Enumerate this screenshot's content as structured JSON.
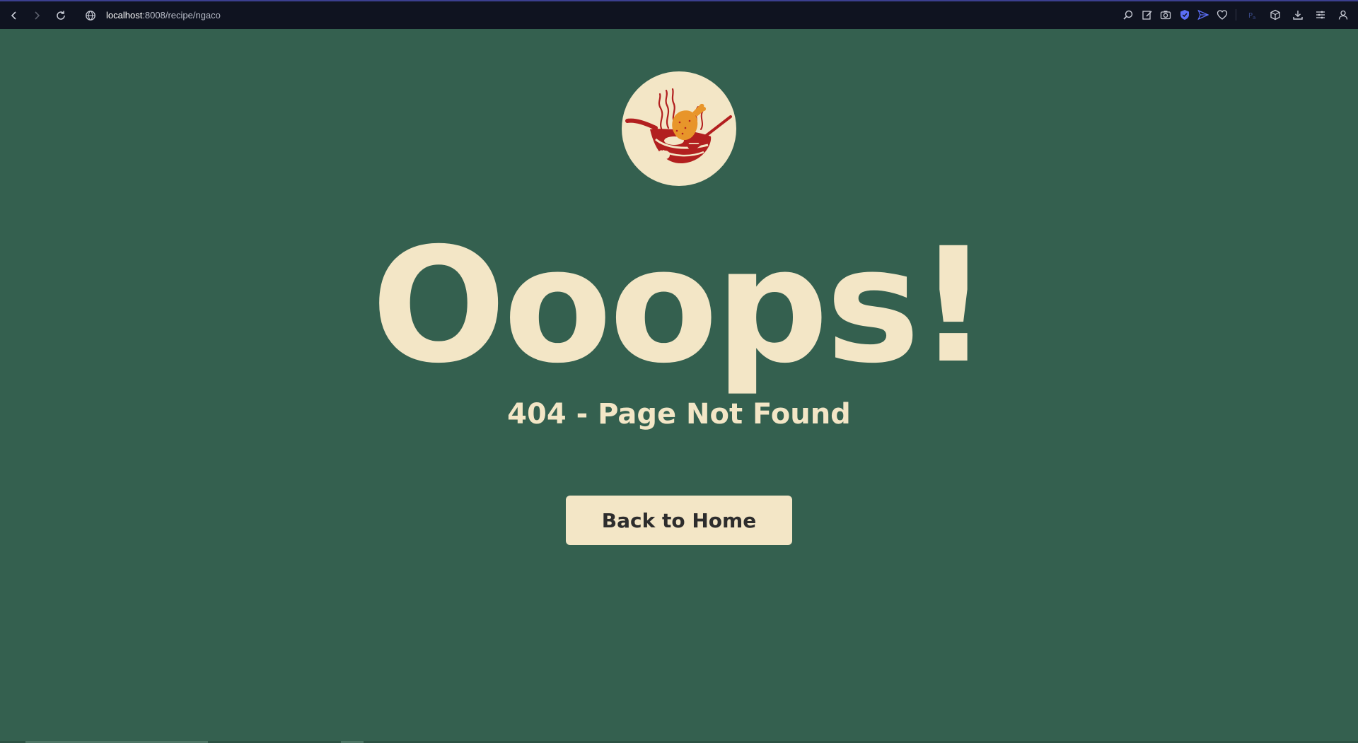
{
  "browser": {
    "url_host": "localhost",
    "url_rest": ":8008/recipe/ngaco",
    "back_icon": "chevron-left-icon",
    "forward_icon": "chevron-right-icon",
    "reload_icon": "reload-icon",
    "toolbar_icons": [
      "zoom-icon",
      "edit-icon",
      "camera-icon",
      "shield-icon",
      "send-icon",
      "heart-icon",
      "extension-icon",
      "box-icon",
      "download-icon",
      "menu-icon",
      "account-icon"
    ]
  },
  "page": {
    "headline": "Ooops!",
    "subheading": "404 - Page Not Found",
    "home_button_label": "Back to Home"
  },
  "colors": {
    "background": "#34604f",
    "cream": "#f3e6c6",
    "button_text": "#2d2d2d",
    "logo_red": "#b21f1f",
    "logo_orange": "#e8952a"
  }
}
